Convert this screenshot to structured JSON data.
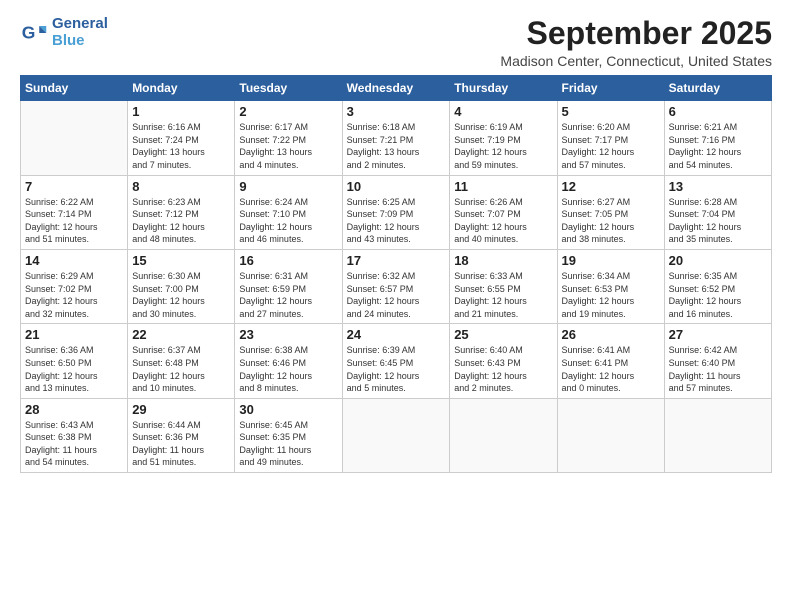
{
  "logo": {
    "line1": "General",
    "line2": "Blue"
  },
  "title": "September 2025",
  "location": "Madison Center, Connecticut, United States",
  "weekdays": [
    "Sunday",
    "Monday",
    "Tuesday",
    "Wednesday",
    "Thursday",
    "Friday",
    "Saturday"
  ],
  "weeks": [
    [
      {
        "day": "",
        "info": ""
      },
      {
        "day": "1",
        "info": "Sunrise: 6:16 AM\nSunset: 7:24 PM\nDaylight: 13 hours\nand 7 minutes."
      },
      {
        "day": "2",
        "info": "Sunrise: 6:17 AM\nSunset: 7:22 PM\nDaylight: 13 hours\nand 4 minutes."
      },
      {
        "day": "3",
        "info": "Sunrise: 6:18 AM\nSunset: 7:21 PM\nDaylight: 13 hours\nand 2 minutes."
      },
      {
        "day": "4",
        "info": "Sunrise: 6:19 AM\nSunset: 7:19 PM\nDaylight: 12 hours\nand 59 minutes."
      },
      {
        "day": "5",
        "info": "Sunrise: 6:20 AM\nSunset: 7:17 PM\nDaylight: 12 hours\nand 57 minutes."
      },
      {
        "day": "6",
        "info": "Sunrise: 6:21 AM\nSunset: 7:16 PM\nDaylight: 12 hours\nand 54 minutes."
      }
    ],
    [
      {
        "day": "7",
        "info": "Sunrise: 6:22 AM\nSunset: 7:14 PM\nDaylight: 12 hours\nand 51 minutes."
      },
      {
        "day": "8",
        "info": "Sunrise: 6:23 AM\nSunset: 7:12 PM\nDaylight: 12 hours\nand 48 minutes."
      },
      {
        "day": "9",
        "info": "Sunrise: 6:24 AM\nSunset: 7:10 PM\nDaylight: 12 hours\nand 46 minutes."
      },
      {
        "day": "10",
        "info": "Sunrise: 6:25 AM\nSunset: 7:09 PM\nDaylight: 12 hours\nand 43 minutes."
      },
      {
        "day": "11",
        "info": "Sunrise: 6:26 AM\nSunset: 7:07 PM\nDaylight: 12 hours\nand 40 minutes."
      },
      {
        "day": "12",
        "info": "Sunrise: 6:27 AM\nSunset: 7:05 PM\nDaylight: 12 hours\nand 38 minutes."
      },
      {
        "day": "13",
        "info": "Sunrise: 6:28 AM\nSunset: 7:04 PM\nDaylight: 12 hours\nand 35 minutes."
      }
    ],
    [
      {
        "day": "14",
        "info": "Sunrise: 6:29 AM\nSunset: 7:02 PM\nDaylight: 12 hours\nand 32 minutes."
      },
      {
        "day": "15",
        "info": "Sunrise: 6:30 AM\nSunset: 7:00 PM\nDaylight: 12 hours\nand 30 minutes."
      },
      {
        "day": "16",
        "info": "Sunrise: 6:31 AM\nSunset: 6:59 PM\nDaylight: 12 hours\nand 27 minutes."
      },
      {
        "day": "17",
        "info": "Sunrise: 6:32 AM\nSunset: 6:57 PM\nDaylight: 12 hours\nand 24 minutes."
      },
      {
        "day": "18",
        "info": "Sunrise: 6:33 AM\nSunset: 6:55 PM\nDaylight: 12 hours\nand 21 minutes."
      },
      {
        "day": "19",
        "info": "Sunrise: 6:34 AM\nSunset: 6:53 PM\nDaylight: 12 hours\nand 19 minutes."
      },
      {
        "day": "20",
        "info": "Sunrise: 6:35 AM\nSunset: 6:52 PM\nDaylight: 12 hours\nand 16 minutes."
      }
    ],
    [
      {
        "day": "21",
        "info": "Sunrise: 6:36 AM\nSunset: 6:50 PM\nDaylight: 12 hours\nand 13 minutes."
      },
      {
        "day": "22",
        "info": "Sunrise: 6:37 AM\nSunset: 6:48 PM\nDaylight: 12 hours\nand 10 minutes."
      },
      {
        "day": "23",
        "info": "Sunrise: 6:38 AM\nSunset: 6:46 PM\nDaylight: 12 hours\nand 8 minutes."
      },
      {
        "day": "24",
        "info": "Sunrise: 6:39 AM\nSunset: 6:45 PM\nDaylight: 12 hours\nand 5 minutes."
      },
      {
        "day": "25",
        "info": "Sunrise: 6:40 AM\nSunset: 6:43 PM\nDaylight: 12 hours\nand 2 minutes."
      },
      {
        "day": "26",
        "info": "Sunrise: 6:41 AM\nSunset: 6:41 PM\nDaylight: 12 hours\nand 0 minutes."
      },
      {
        "day": "27",
        "info": "Sunrise: 6:42 AM\nSunset: 6:40 PM\nDaylight: 11 hours\nand 57 minutes."
      }
    ],
    [
      {
        "day": "28",
        "info": "Sunrise: 6:43 AM\nSunset: 6:38 PM\nDaylight: 11 hours\nand 54 minutes."
      },
      {
        "day": "29",
        "info": "Sunrise: 6:44 AM\nSunset: 6:36 PM\nDaylight: 11 hours\nand 51 minutes."
      },
      {
        "day": "30",
        "info": "Sunrise: 6:45 AM\nSunset: 6:35 PM\nDaylight: 11 hours\nand 49 minutes."
      },
      {
        "day": "",
        "info": ""
      },
      {
        "day": "",
        "info": ""
      },
      {
        "day": "",
        "info": ""
      },
      {
        "day": "",
        "info": ""
      }
    ]
  ]
}
